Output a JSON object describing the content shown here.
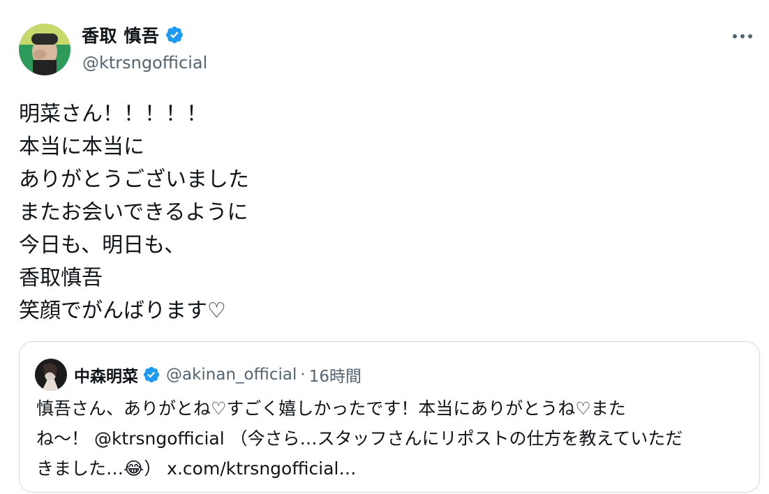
{
  "author": {
    "display_name": "香取 慎吾",
    "handle": "@ktrsngofficial"
  },
  "tweet_lines": [
    "明菜さん！！！！！",
    "本当に本当に",
    "ありがとうございました",
    "またお会いできるように",
    "今日も、明日も、",
    "香取慎吾",
    "笑顔でがんばります♡"
  ],
  "quote": {
    "display_name": "中森明菜",
    "handle": "@akinan_official",
    "separator": "·",
    "time": "16時間",
    "line1": "慎吾さん、ありがとね♡すごく嬉しかったです！本当にありがとうね♡また",
    "line2_a": "ね～！ ",
    "line2_mention": "@ktrsngofficial",
    "line2_b": " （今さら…スタッフさんにリポストの仕方を教えていただ",
    "line3_a": "きました…",
    "line3_emoji": "😂",
    "line3_b": "） x.com/ktrsngofficial…"
  },
  "colors": {
    "verified": "#1d9bf0",
    "secondary_text": "#536471",
    "border": "#cfd9de"
  },
  "icons": {
    "verified": "verified-badge-icon",
    "more": "more-horizontal-icon"
  }
}
